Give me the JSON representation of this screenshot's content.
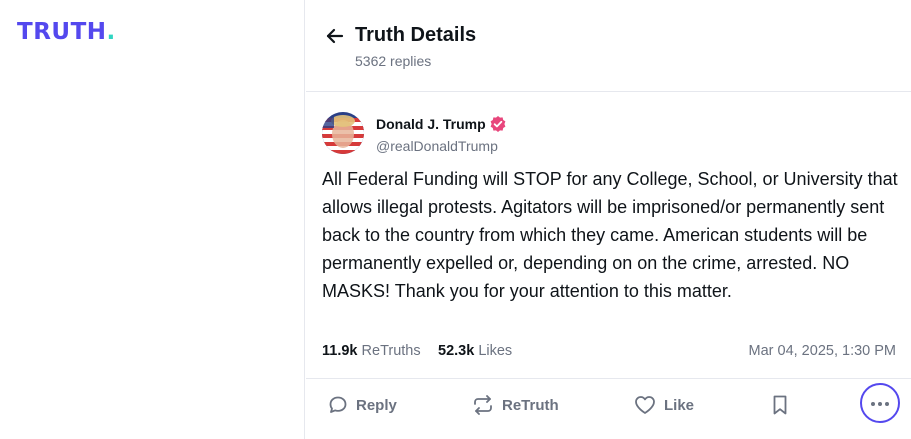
{
  "logo": {
    "text": "TRUTH",
    "dot": "."
  },
  "header": {
    "title": "Truth Details",
    "replies": "5362 replies"
  },
  "post": {
    "author_name": "Donald J. Trump",
    "author_handle": "@realDonaldTrump",
    "verified": true,
    "text": "All Federal Funding will STOP for any College, School, or University that allows illegal protests. Agitators will be imprisoned/or permanently sent back to the country from which they came. American students will be permanently expelled or, depending on on the crime, arrested. NO MASKS! Thank you for your attention to this matter.",
    "retruths_count": "11.9k",
    "retruths_label": "ReTruths",
    "likes_count": "52.3k",
    "likes_label": "Likes",
    "timestamp": "Mar 04, 2025, 1:30 PM"
  },
  "actions": {
    "reply_label": "Reply",
    "retruth_label": "ReTruth",
    "like_label": "Like"
  },
  "icons": {
    "back": "arrow-left-icon",
    "verified": "verified-badge-icon",
    "reply": "speech-bubble-icon",
    "retruth": "repost-arrows-icon",
    "like": "heart-icon",
    "bookmark": "bookmark-icon",
    "more": "ellipsis-icon"
  },
  "colors": {
    "brand": "#5448ee",
    "brand_accent": "#2fd5c2",
    "muted_text": "#6b7280",
    "verified_badge": "#e8467c"
  }
}
